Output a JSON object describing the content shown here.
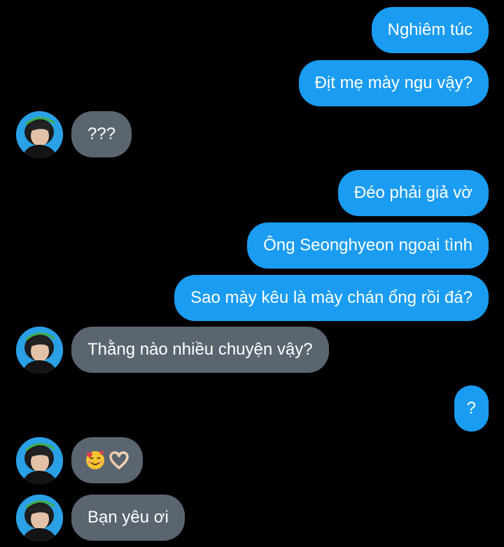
{
  "messages": [
    {
      "side": "sent",
      "text": "Nghiêm túc"
    },
    {
      "side": "sent",
      "text": "Địt mẹ mày ngu vậy?"
    },
    {
      "side": "received",
      "text": "???"
    },
    {
      "side": "sent",
      "text": "Đéo phải giả vờ"
    },
    {
      "side": "sent",
      "text": "Ông Seonghyeon ngoại tình"
    },
    {
      "side": "sent",
      "text": "Sao mày kêu là mày chán ổng rồi đá?"
    },
    {
      "side": "received",
      "text": "Thằng nào nhiều chuyện vậy?"
    },
    {
      "side": "sent",
      "text": "?"
    },
    {
      "side": "received",
      "emoji": [
        "smiling-face-with-hearts",
        "heart-hands"
      ]
    },
    {
      "side": "received",
      "text": "Bạn yêu ơi"
    }
  ],
  "colors": {
    "background": "#000000",
    "sent_bubble": "#1a9cf2",
    "received_bubble": "#5b6570",
    "text": "#ffffff"
  },
  "avatar": {
    "icon": "contact-avatar"
  }
}
